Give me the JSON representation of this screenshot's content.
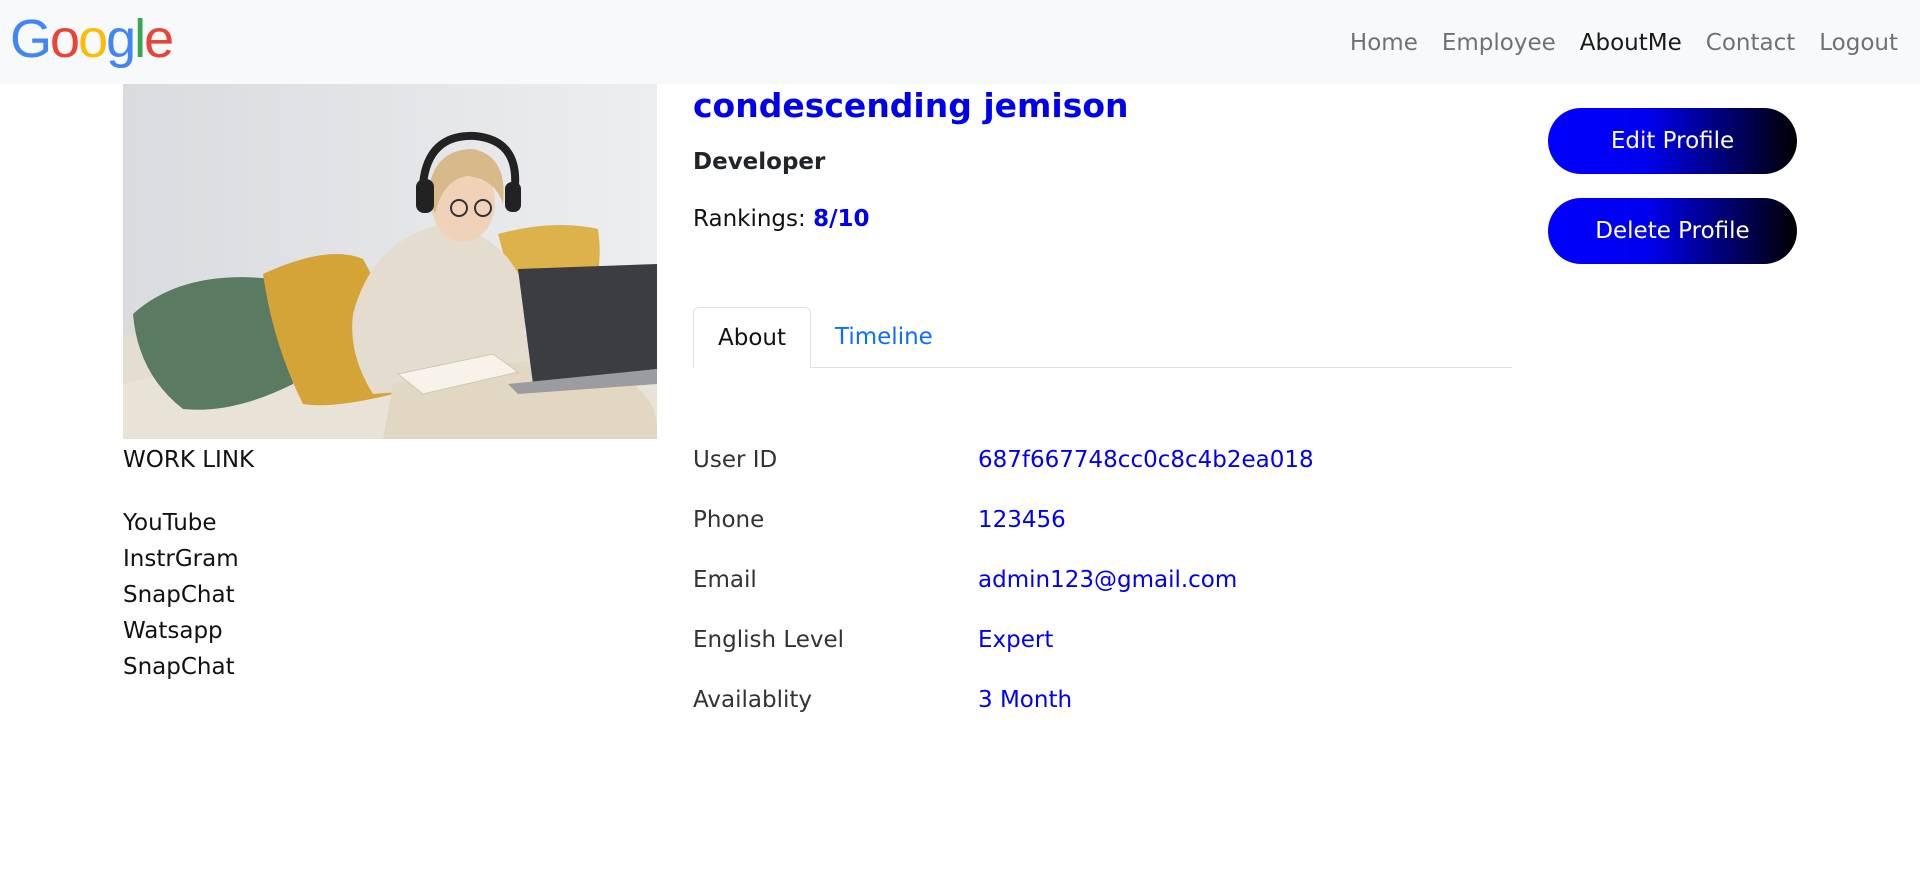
{
  "brand": {
    "name": "Google",
    "colors": [
      "#4285F4",
      "#EA4335",
      "#FBBC05",
      "#4285F4",
      "#34A853",
      "#EA4335"
    ]
  },
  "nav": {
    "items": [
      {
        "label": "Home",
        "active": false
      },
      {
        "label": "Employee",
        "active": false
      },
      {
        "label": "AboutMe",
        "active": true
      },
      {
        "label": "Contact",
        "active": false
      },
      {
        "label": "Logout",
        "active": false
      }
    ]
  },
  "profile": {
    "name": "condescending jemison",
    "role": "Developer",
    "rankings_label": "Rankings:",
    "rankings_value": "8/10",
    "photo": "woman-with-headphones-working-on-laptop"
  },
  "work": {
    "title": "WORK LINK",
    "links": [
      "YouTube",
      "InstrGram",
      "SnapChat",
      "Watsapp",
      "SnapChat"
    ]
  },
  "tabs": [
    {
      "label": "About",
      "active": true
    },
    {
      "label": "Timeline",
      "active": false
    }
  ],
  "about": {
    "rows": [
      {
        "label": "User ID",
        "value": "687f667748cc0c8c4b2ea018"
      },
      {
        "label": "Phone",
        "value": "123456"
      },
      {
        "label": "Email",
        "value": "admin123@gmail.com"
      },
      {
        "label": "English Level",
        "value": "Expert"
      },
      {
        "label": "Availablity",
        "value": "3 Month"
      }
    ]
  },
  "actions": {
    "edit_label": "Edit Profile",
    "delete_label": "Delete Profile"
  },
  "colors": {
    "accent": "#0000ee",
    "nav_bg": "#f8f9fa",
    "tab_link": "#0d6efd"
  }
}
